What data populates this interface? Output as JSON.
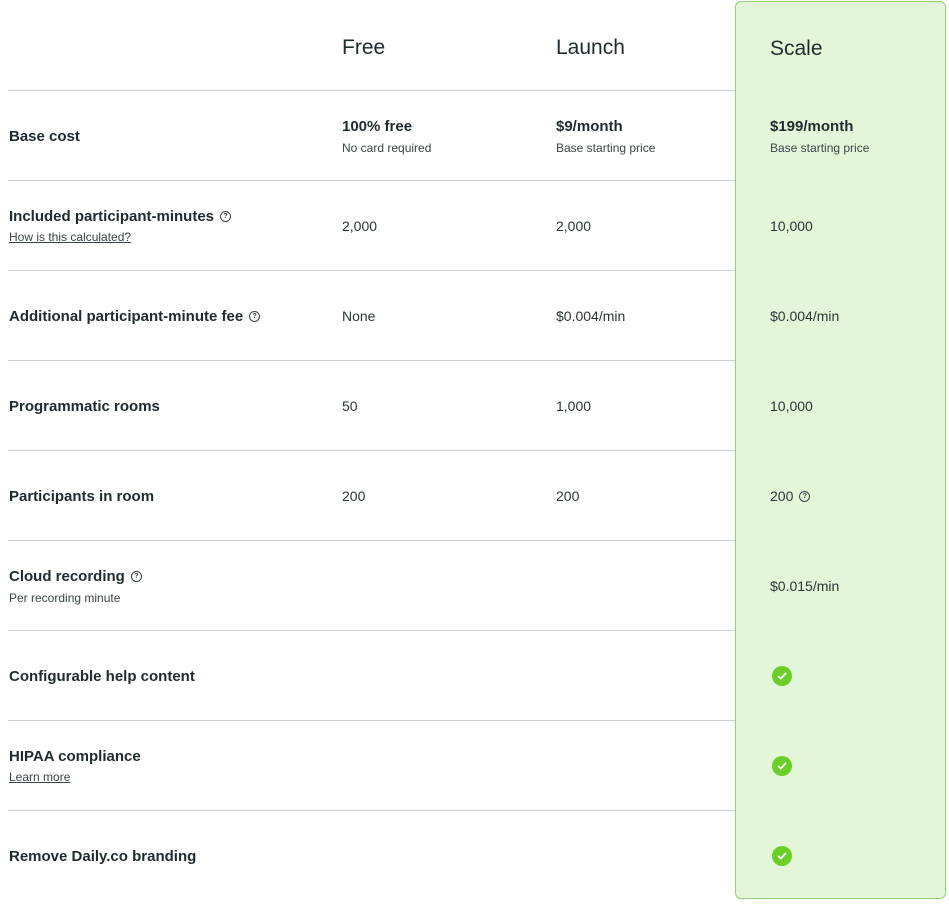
{
  "plans": [
    {
      "name": "Free"
    },
    {
      "name": "Launch"
    },
    {
      "name": "Scale"
    }
  ],
  "rows": {
    "base_cost": {
      "label": "Base cost",
      "free": {
        "price": "100% free",
        "note": "No card required"
      },
      "launch": {
        "price": "$9/month",
        "note": "Base starting price"
      },
      "scale": {
        "price": "$199/month",
        "note": "Base starting price"
      }
    },
    "included_minutes": {
      "label": "Included participant-minutes",
      "link": "How is this calculated?",
      "free": "2,000",
      "launch": "2,000",
      "scale": "10,000"
    },
    "additional_fee": {
      "label": "Additional participant-minute fee",
      "free": "None",
      "launch": "$0.004/min",
      "scale": "$0.004/min"
    },
    "programmatic_rooms": {
      "label": "Programmatic rooms",
      "free": "50",
      "launch": "1,000",
      "scale": "10,000"
    },
    "participants": {
      "label": "Participants in room",
      "free": "200",
      "launch": "200",
      "scale": "200"
    },
    "cloud_recording": {
      "label": "Cloud recording",
      "sub": "Per recording minute",
      "scale": "$0.015/min"
    },
    "help_content": {
      "label": "Configurable help content"
    },
    "hipaa": {
      "label": "HIPAA compliance",
      "link": "Learn more"
    },
    "branding": {
      "label": "Remove Daily.co branding"
    }
  },
  "icons": {
    "help": "question-circle-icon",
    "check": "check-circle-icon"
  },
  "colors": {
    "scale_bg": "#e4f6d8",
    "scale_border": "#8fd37a",
    "check": "#6bcf2a"
  }
}
